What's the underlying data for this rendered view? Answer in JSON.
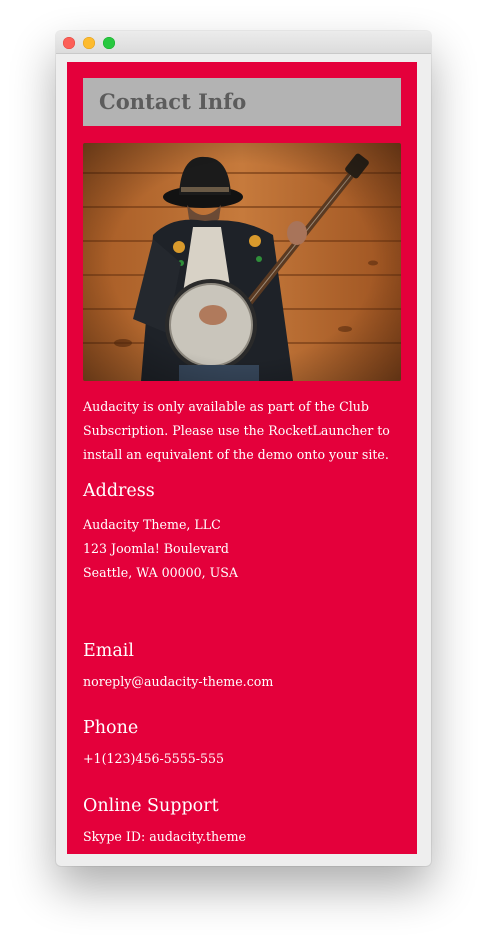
{
  "page": {
    "title": "Contact Info",
    "intro": "Audacity is only available as part of the Club Subscription. Please use the RocketLauncher to install an equivalent of the demo onto your site."
  },
  "photo": {
    "description_icon": "banjo-player-photo"
  },
  "sections": {
    "address": {
      "title": "Address",
      "lines": [
        "Audacity Theme, LLC",
        "123 Joomla! Boulevard",
        "Seattle, WA 00000, USA"
      ]
    },
    "email": {
      "title": "Email",
      "value": "noreply@audacity-theme.com"
    },
    "phone": {
      "title": "Phone",
      "value": "+1(123)456-5555-555"
    },
    "support": {
      "title": "Online Support",
      "value": "Skype ID: audacity.theme"
    }
  },
  "colors": {
    "background": "#e4003b",
    "heading_box": "#b3b3b3",
    "heading_text": "#5c5c5c"
  }
}
